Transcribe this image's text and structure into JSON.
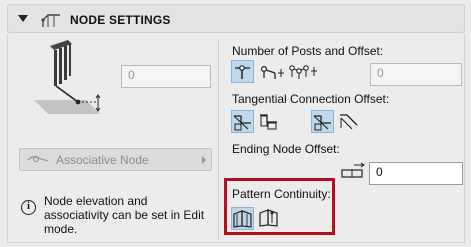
{
  "header": {
    "title": "NODE SETTINGS",
    "icon": "railing-node-icon"
  },
  "left": {
    "elevation_value": "0",
    "associative_button_label": "Associative Node",
    "info_text": "Node elevation and associativity can be set in Edit mode."
  },
  "right": {
    "posts_label": "Number of Posts and Offset:",
    "posts_value": "0",
    "tangential_label": "Tangential Connection Offset:",
    "ending_label": "Ending Node Offset:",
    "ending_value": "0",
    "pattern_label": "Pattern Continuity:"
  },
  "colors": {
    "highlight": "#b4111f",
    "selected_fill": "#bfd8ec",
    "selected_border": "#8fb3d0"
  }
}
